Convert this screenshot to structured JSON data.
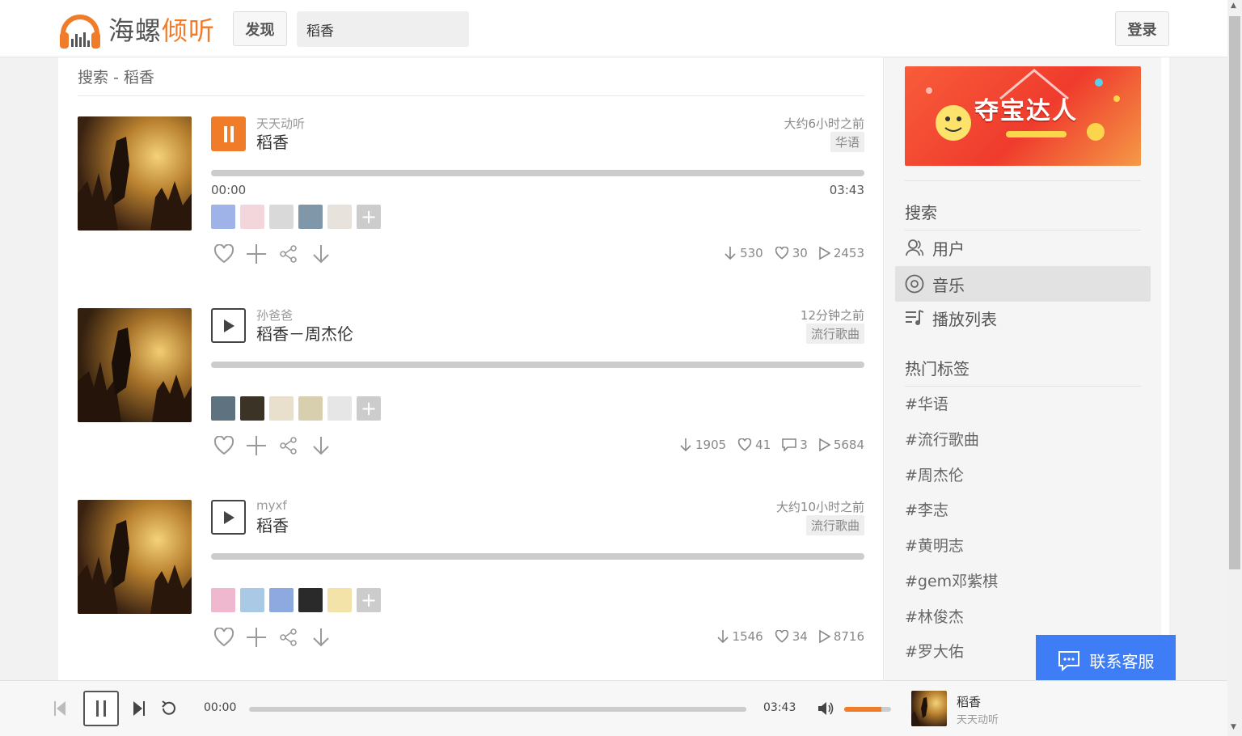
{
  "header": {
    "logo_text_a": "海螺",
    "logo_text_b": "倾听",
    "discover_label": "发现",
    "search_value": "稻香",
    "login_label": "登录"
  },
  "main": {
    "heading": "搜索 - 稻香",
    "tracks": [
      {
        "uploader": "天天动听",
        "title": "稻香",
        "time_ago": "大约6小时之前",
        "tag": "华语",
        "time_current": "00:00",
        "time_total": "03:43",
        "playing": true,
        "stats": {
          "downloads": "530",
          "likes": "30",
          "plays": "2453"
        }
      },
      {
        "uploader": "孙爸爸",
        "title": "稻香－周杰伦",
        "time_ago": "12分钟之前",
        "tag": "流行歌曲",
        "playing": false,
        "stats": {
          "downloads": "1905",
          "likes": "41",
          "comments": "3",
          "plays": "5684"
        }
      },
      {
        "uploader": "myxf",
        "title": "稻香",
        "time_ago": "大约10小时之前",
        "tag": "流行歌曲",
        "playing": false,
        "stats": {
          "downloads": "1546",
          "likes": "34",
          "plays": "8716"
        }
      }
    ],
    "add_avatar_symbol": "+"
  },
  "sidebar": {
    "ad_title": "夺宝达人",
    "search_heading": "搜索",
    "items": [
      {
        "label": "用户",
        "icon": "user-icon"
      },
      {
        "label": "音乐",
        "icon": "music-disc-icon",
        "active": true
      },
      {
        "label": "播放列表",
        "icon": "playlist-icon"
      }
    ],
    "hot_tags_heading": "热门标签",
    "tags": [
      "#华语",
      "#流行歌曲",
      "#周杰伦",
      "#李志",
      "#黄明志",
      "#gem邓紫棋",
      "#林俊杰",
      "#罗大佑"
    ]
  },
  "customer_service": {
    "label": "联系客服"
  },
  "player": {
    "time_current": "00:00",
    "time_total": "03:43",
    "volume": 0.8,
    "title": "稻香",
    "artist": "天天动听"
  },
  "colors": {
    "accent": "#f07c2a",
    "service_blue": "#3f7df7"
  }
}
